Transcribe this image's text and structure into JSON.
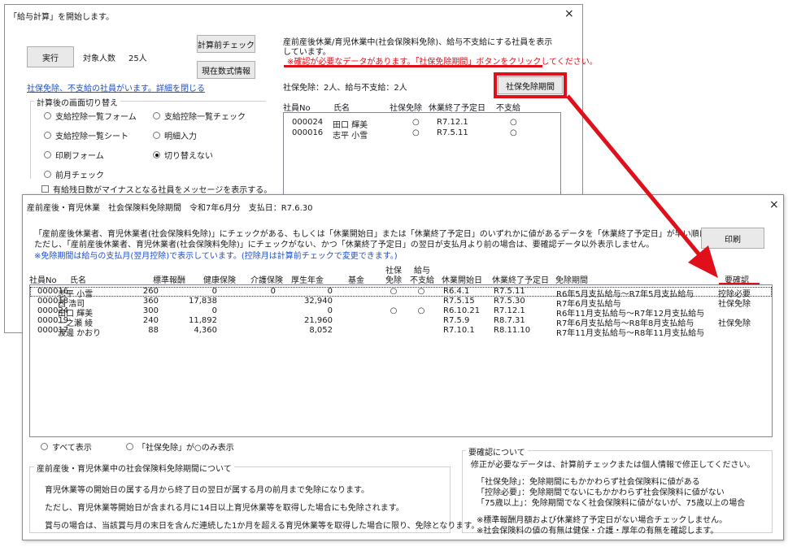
{
  "back_window": {
    "title": "「給与計算」を開始します。",
    "close": "×",
    "run_button": "実行",
    "target_label": "対象人数",
    "target_count": "25人",
    "precalc_check_button": "計算前チェック",
    "show_formula_button": "現在数式情報",
    "link_text": "社保免除、不支給の社員がいます。詳細を閉じる",
    "switch_group_title": "計算後の画面切り替え",
    "radios": [
      {
        "label": "支給控除一覧フォーム",
        "checked": false
      },
      {
        "label": "支給控除一覧チェック",
        "checked": false
      },
      {
        "label": "支給控除一覧シート",
        "checked": false
      },
      {
        "label": "明細入力",
        "checked": false
      },
      {
        "label": "印刷フォーム",
        "checked": false
      },
      {
        "label": "切り替えない",
        "checked": true
      },
      {
        "label": "前月チェック",
        "checked": false
      }
    ],
    "checkbox_label": "有給残日数がマイナスとなる社員をメッセージを表示する。",
    "info_line1": "産前産後休業/育児休業中(社会保険料免除)、給与不支給にする社員を表示",
    "info_line2": "しています。",
    "warning": "※確認が必要なデータがあります。「社保免除期間」ボタンをクリックしてください。",
    "summary": "社保免除：2人、給与不支給：2人",
    "exempt_period_button": "社保免除期間",
    "list_headers": [
      "社員No",
      "氏名",
      "社保免除",
      "休業終了予定日",
      "不支給"
    ],
    "list_rows": [
      {
        "no": "000024",
        "name": "田口 輝美",
        "exempt": "○",
        "end": "R7.12.1",
        "nopay": "○"
      },
      {
        "no": "000016",
        "name": "志平 小雪",
        "exempt": "○",
        "end": "R7.5.11",
        "nopay": "○"
      }
    ]
  },
  "front_window": {
    "title": "産前産後・育児休業　社会保険料免除期間　令和7年6月分　支払日：R7.6.30",
    "close": "×",
    "desc_line1": "「産前産後休業者、育児休業者(社会保険料免除)」にチェックがある、もしくは「休業開始日」または「休業終了予定日」のいずれかに値があるデータを「休業終了予定日」が早い順に表示します。",
    "desc_line2": "ただし、「産前産後休業者、育児休業者(社会保険料免除)」にチェックがない、かつ「休業終了予定日」の翌日が支払月より前の場合は、要確認データ以外表示しません。",
    "desc_line3": "※免除期間は給与の支払月(翌月控除)で表示しています。(控除月は計算前チェックで変更できます。)",
    "print_button": "印刷",
    "headers": {
      "no": "社員No",
      "name": "氏名",
      "std": "標準報酬",
      "health": "健康保険",
      "care": "介護保険",
      "pension": "厚生年金",
      "fund": "基金",
      "exempt1": "社保",
      "exempt2": "免除",
      "nopay1": "給与",
      "nopay2": "不支給",
      "start": "休業開始日",
      "end": "休業終了予定日",
      "period": "免除期間",
      "confirm": "要確認"
    },
    "rows": [
      {
        "no": "000016",
        "name": "志平 小雪",
        "std": "260",
        "health": "0",
        "care": "0",
        "pension": "0",
        "fund": "",
        "exempt": "○",
        "nopay": "○",
        "start": "R6.4.1",
        "end": "R7.5.11",
        "period": "R6年5月支払給与～R7年5月支払給与",
        "confirm": "控除必要"
      },
      {
        "no": "000018",
        "name": "西 浩司",
        "std": "360",
        "health": "17,838",
        "care": "",
        "pension": "32,940",
        "fund": "",
        "exempt": "",
        "nopay": "",
        "start": "R7.5.15",
        "end": "R7.5.30",
        "period": "R7年6月支払給与",
        "confirm": "社保免除"
      },
      {
        "no": "000024",
        "name": "田口 輝美",
        "std": "300",
        "health": "0",
        "care": "",
        "pension": "0",
        "fund": "",
        "exempt": "○",
        "nopay": "○",
        "start": "R6.10.21",
        "end": "R7.12.1",
        "period": "R6年11月支払給与～R7年12月支払給与",
        "confirm": ""
      },
      {
        "no": "000019",
        "name": "一之瀬 綾",
        "std": "240",
        "health": "11,892",
        "care": "",
        "pension": "21,960",
        "fund": "",
        "exempt": "",
        "nopay": "",
        "start": "R7.5.9",
        "end": "R8.7.31",
        "period": "R7年6月支払給与～R8年8月支払給与",
        "confirm": "社保免除"
      },
      {
        "no": "000017",
        "name": "渡邊 かおり",
        "std": "88",
        "health": "4,360",
        "care": "",
        "pension": "8,052",
        "fund": "",
        "exempt": "",
        "nopay": "",
        "start": "R7.10.1",
        "end": "R8.11.10",
        "period": "R7年11月支払給与～R8年11月支払給与",
        "confirm": ""
      }
    ],
    "filter_all": "すべて表示",
    "filter_exempt": "「社保免除」が○のみ表示",
    "about_group_title": "産前産後・育児休業中の社会保険料免除期間について",
    "about_lines": [
      "育児休業等の開始日の属する月から終了日の翌日が属する月の前月まで免除になります。",
      "ただし、育児休業等開始日が含まれる月に14日以上育児休業等を取得した場合にも免除されます。",
      "賞与の場合は、当該賞与月の末日を含んだ連続した1か月を超える育児休業等を取得した場合に限り、免除となります。"
    ],
    "confirm_group_title": "要確認について",
    "confirm_lines": [
      "修正が必要なデータは、計算前チェックまたは個人情報で修正してください。",
      "「社保免除」：免除期間にもかかわらず社会保険料に値がある",
      "「控除必要」：免除期間でないにもかかわらず社会保険料に値がない",
      "「75歳以上」：免除期間でなく社会保険料に値がないが、75歳以上の場合",
      "※標準報酬月額および休業終了予定日がない場合チェックしません。",
      "※社会保険料の値の有無は健保・介護・厚年の有無を確認します。"
    ]
  },
  "colors": {
    "highlight": "#e0101a",
    "link": "#1d4fcf",
    "selection": "#cce8ff"
  }
}
